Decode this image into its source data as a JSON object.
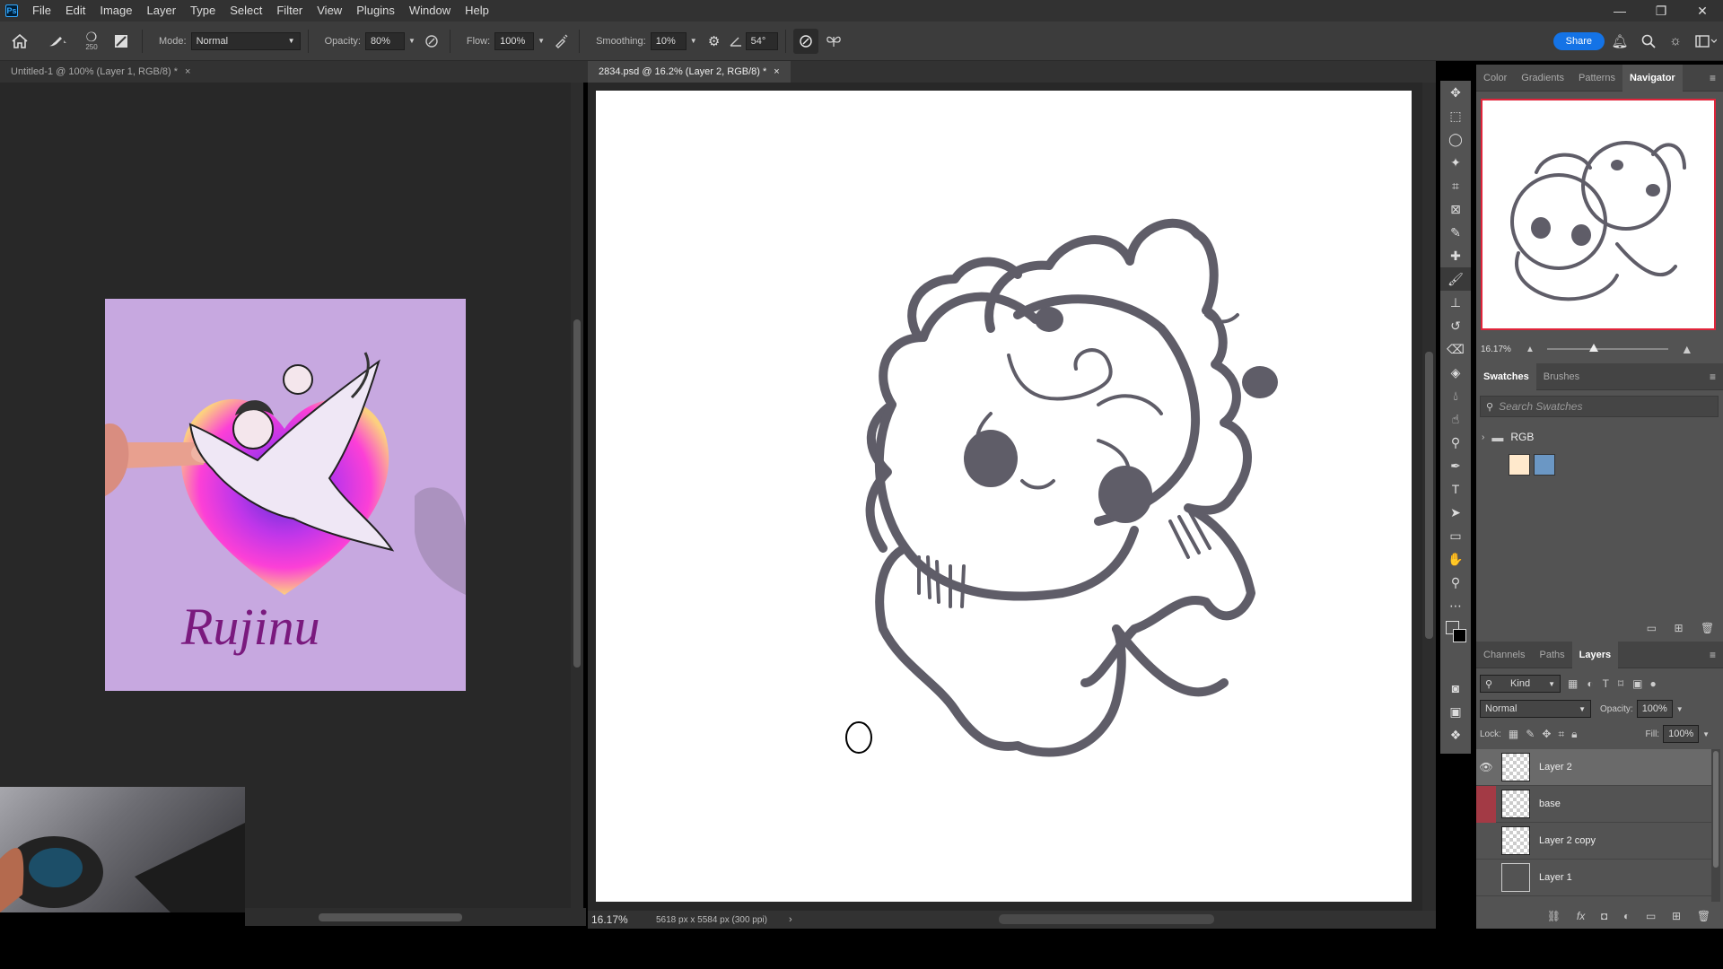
{
  "app": {
    "logo": "Ps",
    "window_controls": [
      "—",
      "❐",
      "✕"
    ]
  },
  "menu": [
    "File",
    "Edit",
    "Image",
    "Layer",
    "Type",
    "Select",
    "Filter",
    "View",
    "Plugins",
    "Window",
    "Help"
  ],
  "options": {
    "brush_size": "250",
    "mode_label": "Mode:",
    "mode_value": "Normal",
    "opacity_label": "Opacity:",
    "opacity_value": "80%",
    "flow_label": "Flow:",
    "flow_value": "100%",
    "smoothing_label": "Smoothing:",
    "smoothing_value": "10%",
    "angle_value": "54°",
    "share_label": "Share"
  },
  "doc_tabs": {
    "left": "Untitled-1 @ 100% (Layer 1, RGB/8) *",
    "right": "2834.psd @ 16.2% (Layer 2, RGB/8) *"
  },
  "reference": {
    "text": "Rujinu"
  },
  "status": {
    "zoom": "16.17%",
    "dimensions": "5618 px x 5584 px (300 ppi)"
  },
  "panels": {
    "top_tabs": [
      "Color",
      "Gradients",
      "Patterns",
      "Navigator"
    ],
    "navigator_zoom": "16.17%",
    "mid_tabs": [
      "Swatches",
      "Brushes"
    ],
    "search_placeholder": "Search Swatches",
    "swatch_group": "RGB",
    "swatches": [
      "#ffe9cc",
      "#6b97c4"
    ],
    "bottom_tabs": [
      "Channels",
      "Paths",
      "Layers"
    ],
    "kind_label": "Kind",
    "blend_mode": "Normal",
    "opacity_label": "Opacity:",
    "opacity_value": "100%",
    "lock_label": "Lock:",
    "fill_label": "Fill:",
    "fill_value": "100%"
  },
  "layers": [
    {
      "name": "Layer 2",
      "visible": true,
      "selected": true
    },
    {
      "name": "base",
      "visible": false,
      "selected": false
    },
    {
      "name": "Layer 2 copy",
      "visible": false,
      "selected": false
    },
    {
      "name": "Layer 1",
      "visible": false,
      "selected": false
    }
  ],
  "colors": {
    "accent": "#1473e6",
    "base_layer_flag": "#a33a45"
  }
}
